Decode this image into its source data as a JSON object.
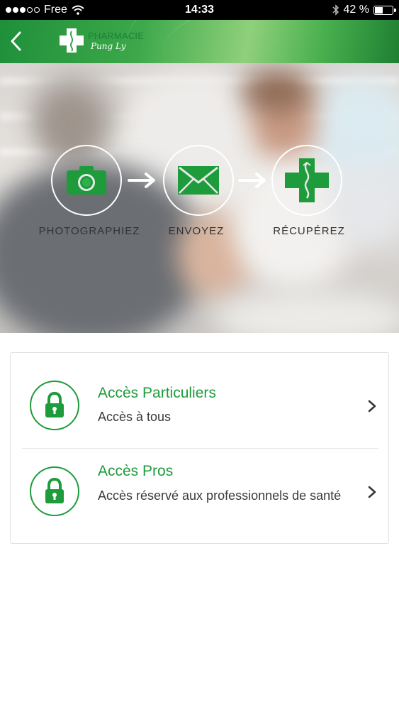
{
  "status_bar": {
    "carrier": "Free",
    "time": "14:33",
    "battery": "42 %",
    "battery_level": 0.42,
    "signal_bars": 3,
    "signal_total": 5
  },
  "header": {
    "logo_title": "PHARMACIE",
    "logo_subtitle": "Pung Ly",
    "back_icon": "chevron-left-icon",
    "brand_green": "#1e9b3b"
  },
  "hero": {
    "steps": [
      {
        "label": "PHOTOGRAPHIEZ",
        "icon": "camera-icon"
      },
      {
        "label": "ENVOYEZ",
        "icon": "envelope-icon"
      },
      {
        "label": "RÉCUPÉREZ",
        "icon": "pharmacy-cross-icon"
      }
    ]
  },
  "access": {
    "items": [
      {
        "title": "Accès Particuliers",
        "subtitle": "Accès à tous",
        "icon": "lock-icon"
      },
      {
        "title": "Accès Pros",
        "subtitle": "Accès réservé aux professionnels de santé",
        "icon": "lock-icon"
      }
    ]
  }
}
